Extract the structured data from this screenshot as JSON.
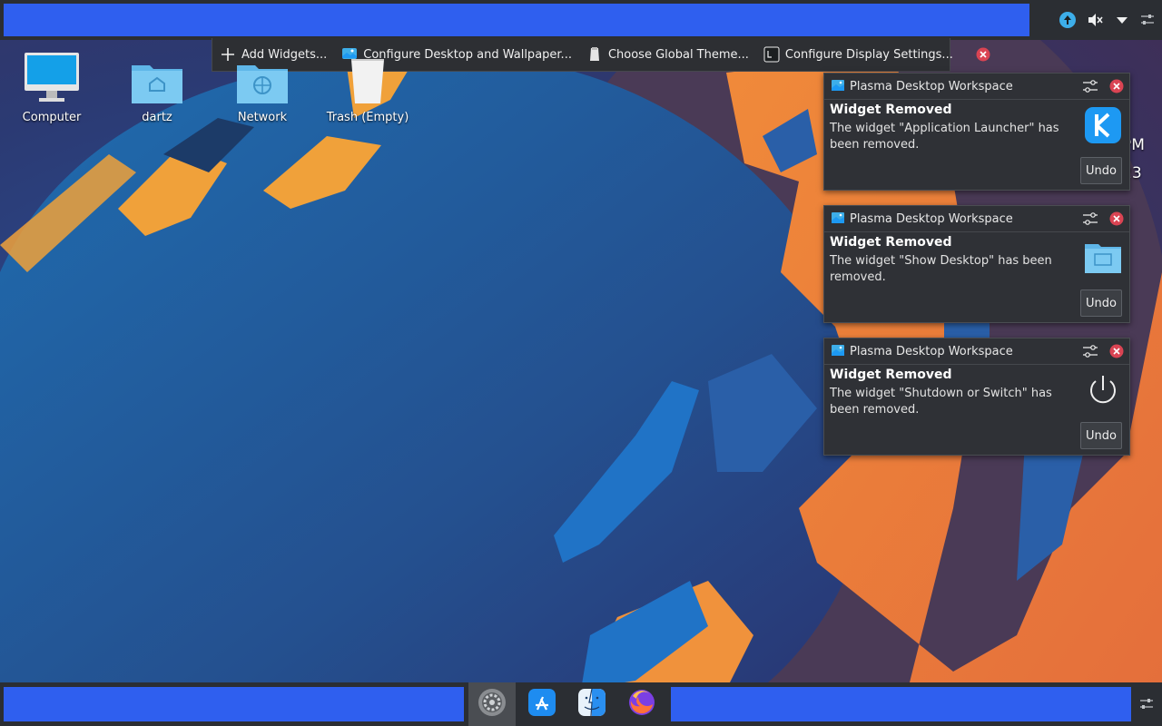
{
  "toolbox": {
    "add_widgets": "Add Widgets...",
    "configure_desktop": "Configure Desktop and Wallpaper...",
    "choose_theme": "Choose Global Theme...",
    "display_settings": "Configure Display Settings..."
  },
  "desktop_icons": [
    {
      "label": "Computer",
      "icon": "computer-icon"
    },
    {
      "label": "dartz",
      "icon": "home-folder-icon"
    },
    {
      "label": "Network",
      "icon": "network-folder-icon"
    },
    {
      "label": "Trash (Empty)",
      "icon": "trash-icon"
    }
  ],
  "clock": {
    "line1": "PM",
    "line2": "23"
  },
  "notifications": [
    {
      "app": "Plasma Desktop Workspace",
      "title": "Widget Removed",
      "body": "The widget \"Application Launcher\" has been removed.",
      "icon": "kde-logo-icon",
      "action": "Undo"
    },
    {
      "app": "Plasma Desktop Workspace",
      "title": "Widget Removed",
      "body": "The widget \"Show Desktop\" has been removed.",
      "icon": "show-desktop-icon",
      "action": "Undo"
    },
    {
      "app": "Plasma Desktop Workspace",
      "title": "Widget Removed",
      "body": "The widget \"Shutdown or Switch\" has been removed.",
      "icon": "power-icon",
      "action": "Undo"
    }
  ],
  "tray": [
    "update-icon",
    "volume-muted-icon",
    "expand-arrow-icon",
    "panel-settings-icon"
  ],
  "taskbar": [
    "system-settings-icon",
    "app-store-icon",
    "finder-icon",
    "firefox-icon"
  ],
  "colors": {
    "panel": "#2b2e33",
    "panel_highlight": "#2f5fef",
    "close": "#da4453",
    "accent": "#3daee9"
  }
}
